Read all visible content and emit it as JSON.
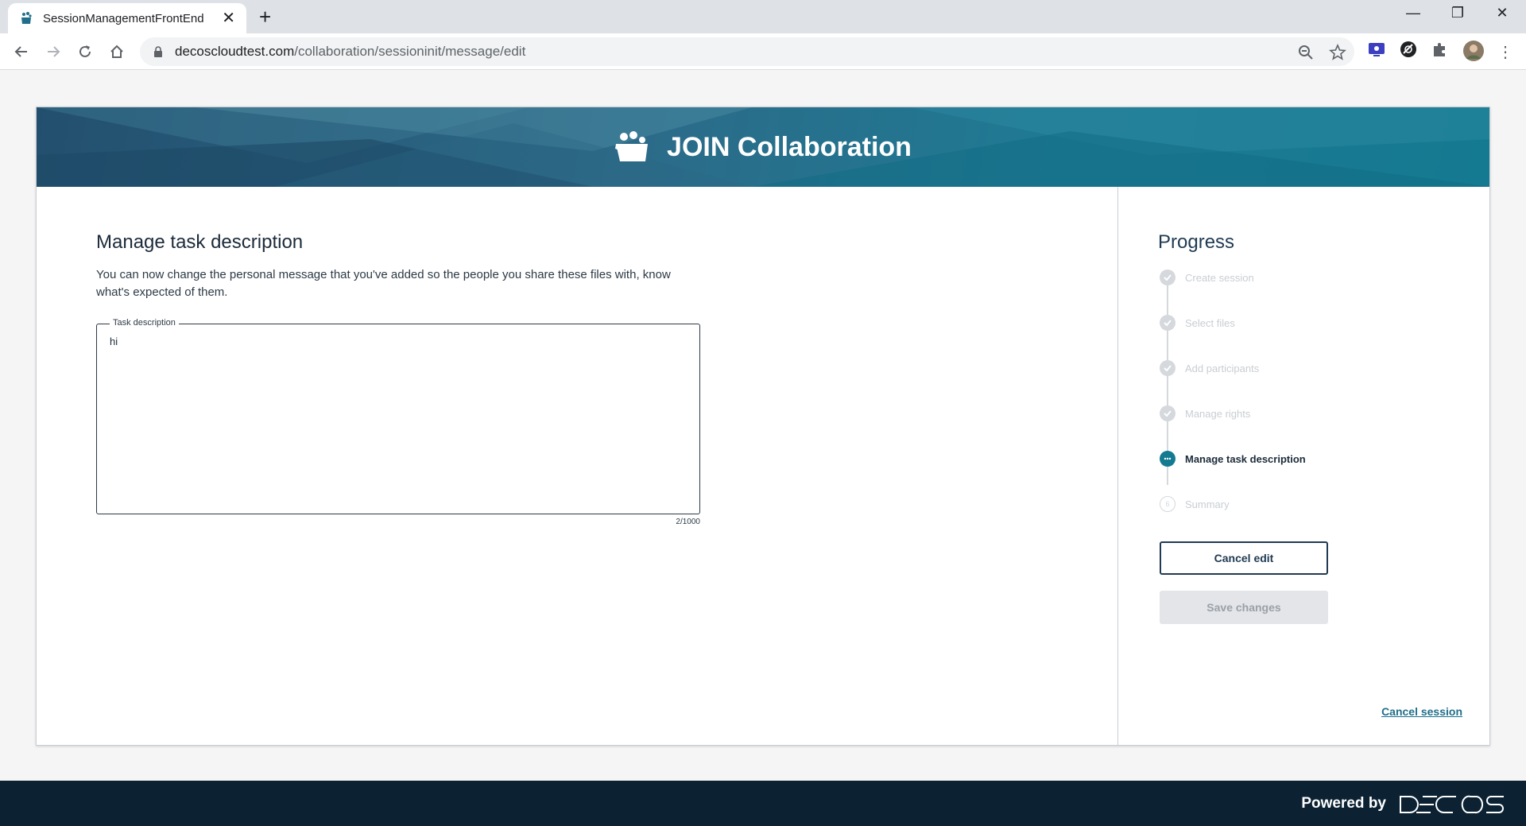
{
  "browser": {
    "tab_title": "SessionManagementFrontEnd",
    "url_host": "decoscloudtest.com",
    "url_path": "/collaboration/sessioninit/message/edit"
  },
  "app": {
    "title": "JOIN Collaboration"
  },
  "main": {
    "page_title": "Manage task description",
    "intro": "You can now change the personal message that you've added so the people you share these files with, know what's expected of them.",
    "field_label": "Task description",
    "field_value": "hi",
    "counter": "2/1000"
  },
  "progress": {
    "title": "Progress",
    "steps": [
      {
        "label": "Create session",
        "state": "done"
      },
      {
        "label": "Select files",
        "state": "done"
      },
      {
        "label": "Add participants",
        "state": "done"
      },
      {
        "label": "Manage rights",
        "state": "done"
      },
      {
        "label": "Manage task description",
        "state": "active"
      },
      {
        "label": "Summary",
        "state": "pending"
      }
    ],
    "cancel_edit_label": "Cancel edit",
    "save_label": "Save changes",
    "cancel_session_label": "Cancel session"
  },
  "footer": {
    "powered_by": "Powered by",
    "brand": "DECOS"
  },
  "colors": {
    "accent": "#147a91",
    "navy": "#1f3a52",
    "footer": "#0c2233"
  }
}
